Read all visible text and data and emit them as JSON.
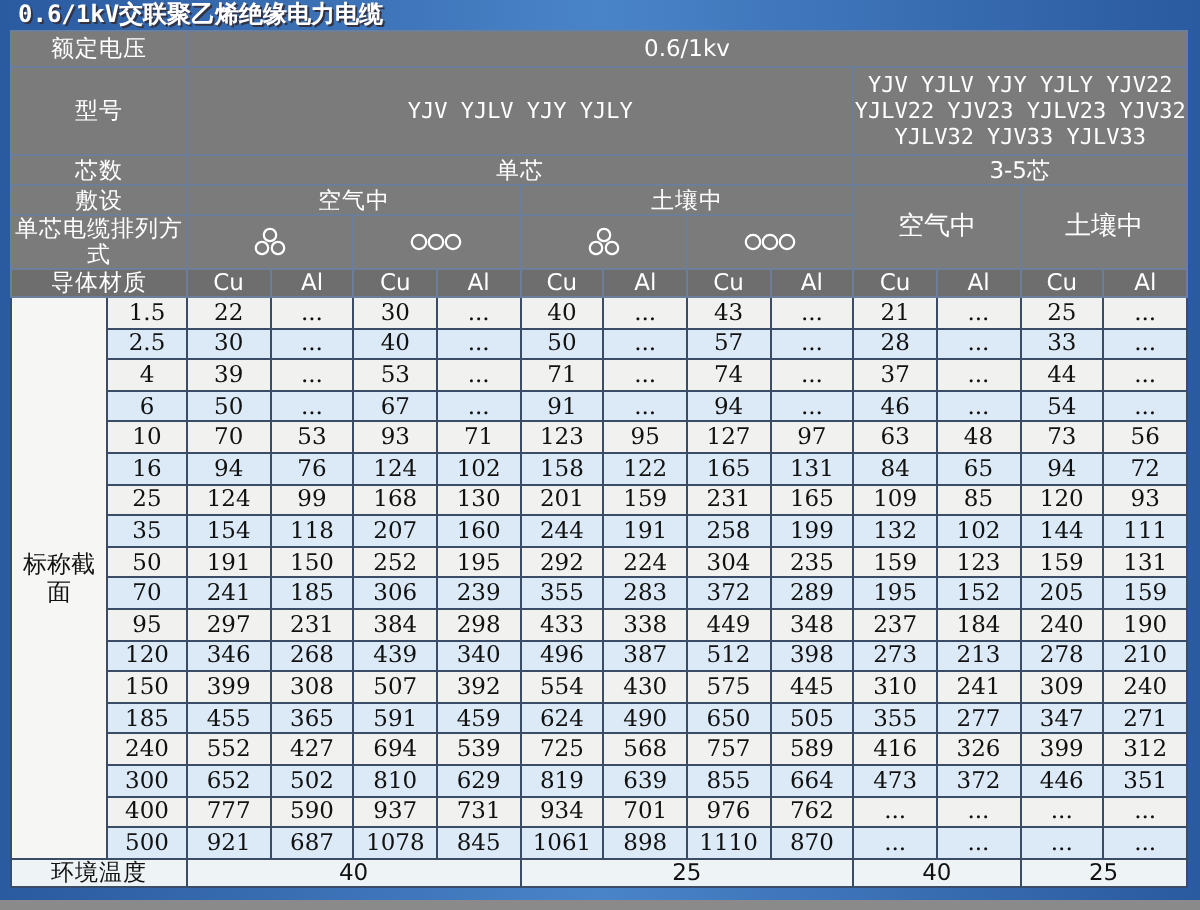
{
  "title": "0.6/1kV交联聚乙烯绝缘电力电缆",
  "table": {
    "rated_voltage": {
      "label": "额定电压",
      "value": "0.6/1kv"
    },
    "model": {
      "label": "型号",
      "single_core": "YJV YJLV YJY YJLY",
      "multi_core_lines": [
        "YJV YJLV YJY YJLY YJV22",
        "YJLV22 YJV23 YJLV23 YJV32",
        "YJLV32 YJV33 YJLV33"
      ]
    },
    "cores": {
      "label": "芯数",
      "single": "单芯",
      "multi": "3-5芯"
    },
    "laying": {
      "label": "敷设",
      "groups": [
        "空气中",
        "土壤中",
        "空气中",
        "土壤中"
      ]
    },
    "arrangement": {
      "label": "单芯电缆排列方式",
      "items": [
        {
          "kind": "trefoil"
        },
        {
          "kind": "flat"
        },
        {
          "kind": "trefoil"
        },
        {
          "kind": "flat"
        }
      ]
    },
    "material": {
      "label": "导体材质",
      "columns": [
        "Cu",
        "Al",
        "Cu",
        "Al",
        "Cu",
        "Al",
        "Cu",
        "Al",
        "Cu",
        "Al",
        "Cu",
        "Al"
      ]
    },
    "section_label": "标称截面",
    "rows": [
      {
        "size": "1.5",
        "values": [
          "22",
          "...",
          "30",
          "...",
          "40",
          "...",
          "43",
          "...",
          "21",
          "...",
          "25",
          "..."
        ]
      },
      {
        "size": "2.5",
        "values": [
          "30",
          "...",
          "40",
          "...",
          "50",
          "...",
          "57",
          "...",
          "28",
          "...",
          "33",
          "..."
        ]
      },
      {
        "size": "4",
        "values": [
          "39",
          "...",
          "53",
          "...",
          "71",
          "...",
          "74",
          "...",
          "37",
          "...",
          "44",
          "..."
        ]
      },
      {
        "size": "6",
        "values": [
          "50",
          "...",
          "67",
          "...",
          "91",
          "...",
          "94",
          "...",
          "46",
          "...",
          "54",
          "..."
        ]
      },
      {
        "size": "10",
        "values": [
          "70",
          "53",
          "93",
          "71",
          "123",
          "95",
          "127",
          "97",
          "63",
          "48",
          "73",
          "56"
        ]
      },
      {
        "size": "16",
        "values": [
          "94",
          "76",
          "124",
          "102",
          "158",
          "122",
          "165",
          "131",
          "84",
          "65",
          "94",
          "72"
        ]
      },
      {
        "size": "25",
        "values": [
          "124",
          "99",
          "168",
          "130",
          "201",
          "159",
          "231",
          "165",
          "109",
          "85",
          "120",
          "93"
        ]
      },
      {
        "size": "35",
        "values": [
          "154",
          "118",
          "207",
          "160",
          "244",
          "191",
          "258",
          "199",
          "132",
          "102",
          "144",
          "111"
        ]
      },
      {
        "size": "50",
        "values": [
          "191",
          "150",
          "252",
          "195",
          "292",
          "224",
          "304",
          "235",
          "159",
          "123",
          "159",
          "131"
        ]
      },
      {
        "size": "70",
        "values": [
          "241",
          "185",
          "306",
          "239",
          "355",
          "283",
          "372",
          "289",
          "195",
          "152",
          "205",
          "159"
        ]
      },
      {
        "size": "95",
        "values": [
          "297",
          "231",
          "384",
          "298",
          "433",
          "338",
          "449",
          "348",
          "237",
          "184",
          "240",
          "190"
        ]
      },
      {
        "size": "120",
        "values": [
          "346",
          "268",
          "439",
          "340",
          "496",
          "387",
          "512",
          "398",
          "273",
          "213",
          "278",
          "210"
        ]
      },
      {
        "size": "150",
        "values": [
          "399",
          "308",
          "507",
          "392",
          "554",
          "430",
          "575",
          "445",
          "310",
          "241",
          "309",
          "240"
        ]
      },
      {
        "size": "185",
        "values": [
          "455",
          "365",
          "591",
          "459",
          "624",
          "490",
          "650",
          "505",
          "355",
          "277",
          "347",
          "271"
        ]
      },
      {
        "size": "240",
        "values": [
          "552",
          "427",
          "694",
          "539",
          "725",
          "568",
          "757",
          "589",
          "416",
          "326",
          "399",
          "312"
        ]
      },
      {
        "size": "300",
        "values": [
          "652",
          "502",
          "810",
          "629",
          "819",
          "639",
          "855",
          "664",
          "473",
          "372",
          "446",
          "351"
        ]
      },
      {
        "size": "400",
        "values": [
          "777",
          "590",
          "937",
          "731",
          "934",
          "701",
          "976",
          "762",
          "...",
          "...",
          "...",
          "..."
        ]
      },
      {
        "size": "500",
        "values": [
          "921",
          "687",
          "1078",
          "845",
          "1061",
          "898",
          "1110",
          "870",
          "...",
          "...",
          "...",
          "..."
        ]
      }
    ],
    "ambient": {
      "label": "环境温度",
      "values": [
        "40",
        "25",
        "40",
        "25"
      ]
    }
  }
}
